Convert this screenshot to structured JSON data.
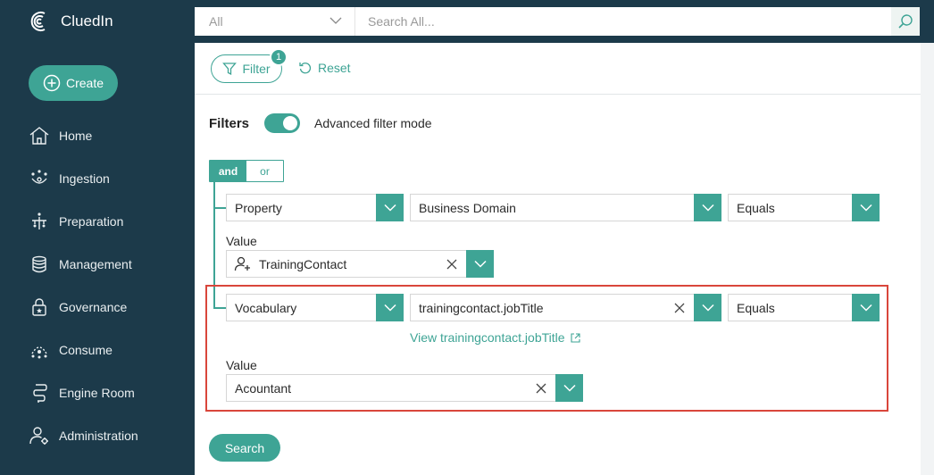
{
  "app": {
    "name": "CluedIn"
  },
  "search": {
    "scope": "All",
    "placeholder": "Search All..."
  },
  "sidebar": {
    "create_label": "Create",
    "items": [
      {
        "label": "Home",
        "icon": "home-icon"
      },
      {
        "label": "Ingestion",
        "icon": "ingestion-icon"
      },
      {
        "label": "Preparation",
        "icon": "preparation-icon"
      },
      {
        "label": "Management",
        "icon": "management-icon"
      },
      {
        "label": "Governance",
        "icon": "governance-icon"
      },
      {
        "label": "Consume",
        "icon": "consume-icon"
      },
      {
        "label": "Engine Room",
        "icon": "engine-room-icon"
      },
      {
        "label": "Administration",
        "icon": "administration-icon"
      }
    ]
  },
  "toolbar": {
    "filter_label": "Filter",
    "filter_count": "1",
    "reset_label": "Reset"
  },
  "filters": {
    "title": "Filters",
    "advanced_mode_label": "Advanced filter mode",
    "advanced_mode_on": true,
    "operator_and": "and",
    "operator_or": "or",
    "rule1": {
      "field_type": "Property",
      "field": "Business Domain",
      "operator": "Equals",
      "value_label": "Value",
      "value": "TrainingContact"
    },
    "rule2": {
      "field_type": "Vocabulary",
      "field": "trainingcontact.jobTitle",
      "operator": "Equals",
      "view_link": "View trainingcontact.jobTitle",
      "value_label": "Value",
      "value": "Acountant"
    },
    "search_label": "Search"
  },
  "colors": {
    "accent": "#3ea495",
    "sidebar": "#1c3a4a",
    "highlight": "#d9463b"
  }
}
